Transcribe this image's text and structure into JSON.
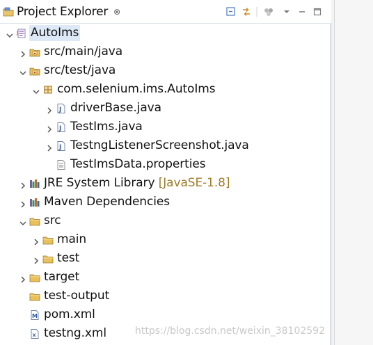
{
  "view": {
    "tab_title": "Project Explorer",
    "close_glyph": "⊗"
  },
  "tree": [
    {
      "label": "AutoIms",
      "level": 0,
      "expanded": true,
      "icon": "maven-project-icon",
      "selected": true
    },
    {
      "label": "src/main/java",
      "level": 1,
      "expanded": false,
      "icon": "source-folder-icon"
    },
    {
      "label": "src/test/java",
      "level": 1,
      "expanded": true,
      "icon": "source-folder-icon"
    },
    {
      "label": "com.selenium.ims.AutoIms",
      "level": 2,
      "expanded": true,
      "icon": "package-icon"
    },
    {
      "label": "driverBase.java",
      "level": 3,
      "expanded": false,
      "icon": "java-file-icon"
    },
    {
      "label": "TestIms.java",
      "level": 3,
      "expanded": false,
      "icon": "java-file-icon"
    },
    {
      "label": "TestngListenerScreenshot.java",
      "level": 3,
      "expanded": false,
      "icon": "java-file-icon"
    },
    {
      "label": "TestImsData.properties",
      "level": 3,
      "icon": "properties-file-icon"
    },
    {
      "label": "JRE System Library",
      "decoration": "[JavaSE-1.8]",
      "level": 1,
      "expanded": false,
      "icon": "library-icon"
    },
    {
      "label": "Maven Dependencies",
      "level": 1,
      "expanded": false,
      "icon": "library-icon"
    },
    {
      "label": "src",
      "level": 1,
      "expanded": true,
      "icon": "folder-icon"
    },
    {
      "label": "main",
      "level": 2,
      "expanded": false,
      "icon": "folder-icon"
    },
    {
      "label": "test",
      "level": 2,
      "expanded": false,
      "icon": "folder-icon"
    },
    {
      "label": "target",
      "level": 1,
      "expanded": false,
      "icon": "folder-icon"
    },
    {
      "label": "test-output",
      "level": 1,
      "icon": "folder-icon"
    },
    {
      "label": "pom.xml",
      "level": 1,
      "icon": "pom-file-icon"
    },
    {
      "label": "testng.xml",
      "level": 1,
      "icon": "xml-file-icon"
    }
  ],
  "watermark": "https://blog.csdn.net/weixin_38102592",
  "colors": {
    "selection": "#dde9f7",
    "folder": "#e8c15a",
    "decoration": "#a07c2a"
  }
}
